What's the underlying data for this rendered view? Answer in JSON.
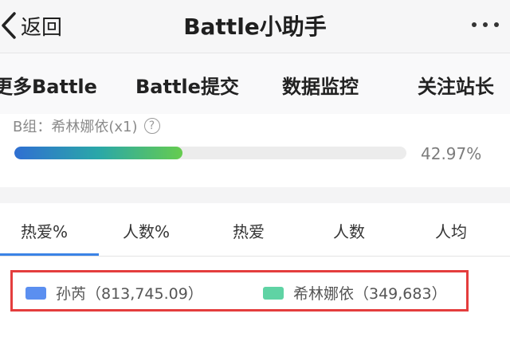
{
  "header": {
    "back_label": "返回",
    "title": "Battle小助手"
  },
  "topmenu": {
    "items": [
      "更多Battle",
      "Battle提交",
      "数据监控",
      "关注站长"
    ]
  },
  "group": {
    "label": "B组：希林娜依(x1)",
    "progress_percent": 42.97,
    "progress_text": "42.97%",
    "bar_colors": [
      "#2f6fd2",
      "#2aa7a8",
      "#66cc4f"
    ]
  },
  "tabs": {
    "items": [
      "热爱%",
      "人数%",
      "热爱",
      "人数",
      "人均"
    ],
    "active_index": 0,
    "active_color": "#3b83e6"
  },
  "legend": {
    "items": [
      {
        "label": "孙芮（813,745.09）",
        "color": "#5b8ff0"
      },
      {
        "label": "希林娜依（349,683）",
        "color": "#5fd3a4"
      }
    ],
    "highlight_color": "#e43d3d"
  }
}
